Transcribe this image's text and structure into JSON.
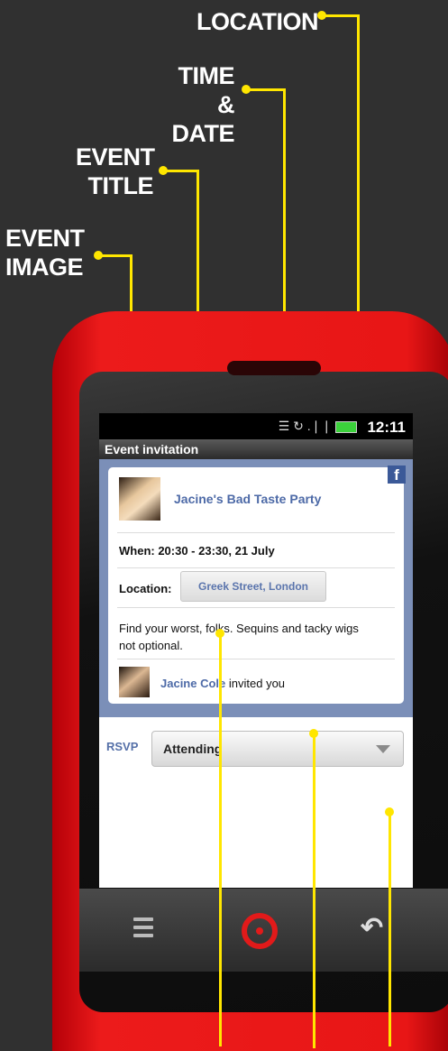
{
  "callouts": {
    "location": "LOCATION",
    "time_date_1": "TIME &",
    "time_date_2": "DATE",
    "event_title_1": "EVENT",
    "event_title_2": "TITLE",
    "event_image_1": "EVENT",
    "event_image_2": "IMAGE"
  },
  "status": {
    "time": "12:11",
    "icons": "☰ ↻ .❘❘"
  },
  "titlebar": {
    "title": "Event invitation"
  },
  "event": {
    "title": "Jacine's Bad Taste Party",
    "when": "When: 20:30 - 23:30, 21 July",
    "location_label": "Location:",
    "location_value": "Greek Street, London",
    "description": "Find your worst, folks. Sequins and tacky wigs not optional.",
    "inviter_name": "Jacine Cole",
    "inviter_suffix": " invited you"
  },
  "rsvp": {
    "label": "RSVP",
    "value": "Attending"
  },
  "colors": {
    "accent": "#ffe600",
    "phone": "#e81616",
    "link": "#4d6aa7"
  },
  "icons": [
    "facebook-icon",
    "menu-icon",
    "search-icon",
    "back-icon"
  ]
}
